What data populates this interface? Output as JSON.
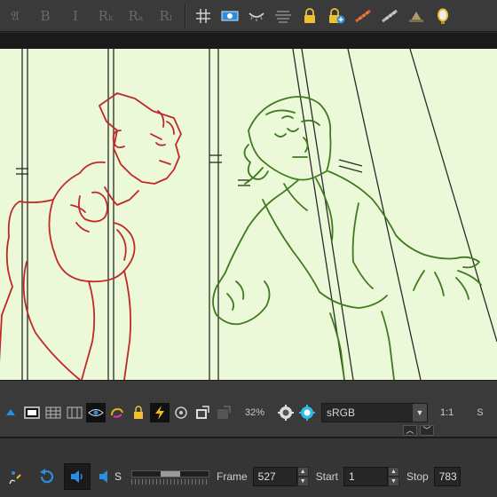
{
  "top_toolbar": {
    "text_buttons": [
      "𝔄",
      "B",
      "I",
      "Rₖ",
      "Rₐ",
      "Rₗ"
    ],
    "icons": [
      "grid-icon",
      "onion-skin-icon",
      "light-table-icon",
      "align-icon",
      "lock-icon",
      "add-lock-icon",
      "ruler-icon",
      "ruler-alt-icon",
      "hat-icon",
      "mirror-icon"
    ]
  },
  "camera_toolbar": {
    "zoom": "32%",
    "color_space": "sRGB",
    "ratio": "1:1",
    "extra": "S"
  },
  "playback": {
    "sound_label": "S",
    "frame_label": "Frame",
    "frame_value": "527",
    "start_label": "Start",
    "start_value": "1",
    "stop_label": "Stop",
    "stop_value": "783",
    "slider_value": 0.5
  },
  "colors": {
    "canvas_bg": "#ecf9d8",
    "red_character": "#c0282a",
    "green_character": "#3f7a1f",
    "accent_blue": "#2a8de0",
    "ui_gray": "#3a3a3a"
  }
}
